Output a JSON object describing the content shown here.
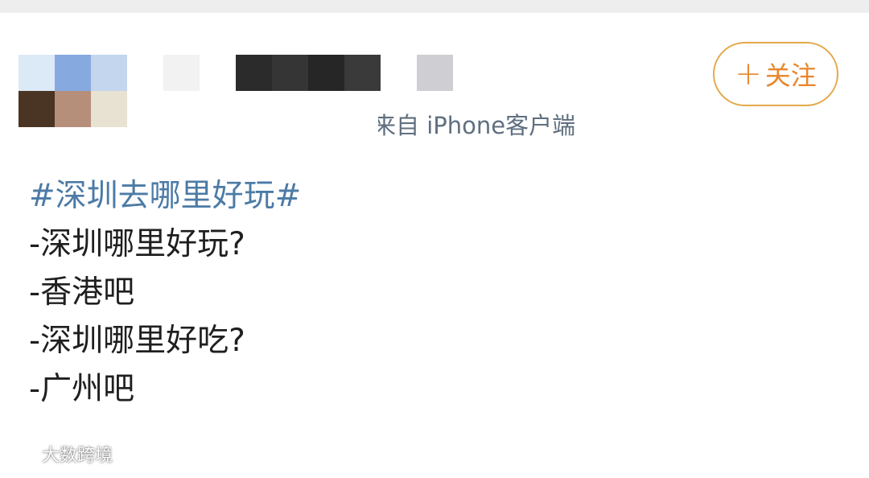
{
  "colors": {
    "hashtag": "#4c7ba6",
    "follow_accent": "#e8862c",
    "follow_border": "#e3a94a",
    "source_text": "#5f6f7f",
    "body_text": "#1f1f1f"
  },
  "author": {
    "avatar_mosaic": [
      "#dce9f6",
      "#86a9e0",
      "#c3d6ee",
      "#4a3424",
      "#b68f7b",
      "#e8e2d2"
    ],
    "name_mosaic": [
      "#f2f2f2",
      "#2b2b2b",
      "#353535",
      "#262626",
      "#3a3a3a",
      "#cfcfd3"
    ],
    "source_lead": "来",
    "source_rest": "自 iPhone客户端"
  },
  "follow": {
    "icon": "plus-icon",
    "plus": "+",
    "label": "关注"
  },
  "post": {
    "hashtag": "#深圳去哪里好玩#",
    "lines": [
      "-深圳哪里好玩?",
      "-香港吧",
      "-深圳哪里好吃?",
      "-广州吧"
    ]
  },
  "watermark": {
    "icon": "dashu-logo-icon",
    "text": "大数跨境"
  }
}
